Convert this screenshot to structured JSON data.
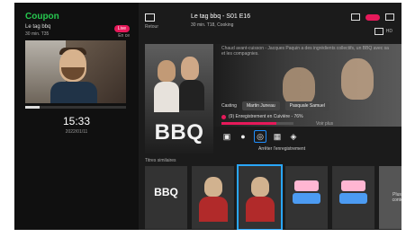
{
  "left_panel": {
    "brand": "Coupon",
    "clock_small": "",
    "channel_title": "Le tag bbq",
    "channel_sub": "30 min. T35",
    "live_badge": "Live",
    "right_meta": "En ce",
    "big_time": "15:33",
    "big_date": "2022/01/11",
    "progress_value": 0.14
  },
  "header": {
    "back_label": "Retour",
    "title": "Le tag bbq - S01 E16",
    "meta": "30 min. T18, Cooking",
    "hd_text": "HD"
  },
  "hero": {
    "poster_text": "BBQ",
    "description": "Chaud avant-cuisson - Jacques Paquin a des ingrédients collectifs, un BBQ avec sa et les compagnies.",
    "casting_label": "Casting",
    "casting_chips": [
      "Martin Juneau",
      "Pasquale Samuel"
    ],
    "record_text": "(9) Enregistrement en Cuivière - 76%",
    "record_progress": 0.76,
    "voir_plus": "Voir plus",
    "actions_label": "Arrêter l'enregistrement"
  },
  "bottom": {
    "section_label": "Titres similaires",
    "cards": [
      {
        "title": "BBQ"
      },
      {
        "title": ""
      },
      {
        "title": ""
      },
      {
        "title": ""
      },
      {
        "title": ""
      },
      {
        "title": "Plus de contenu"
      }
    ]
  },
  "colors": {
    "accent_pink": "#e6195a",
    "accent_blue": "#2aa7ff",
    "brand_green": "#26c84f"
  }
}
